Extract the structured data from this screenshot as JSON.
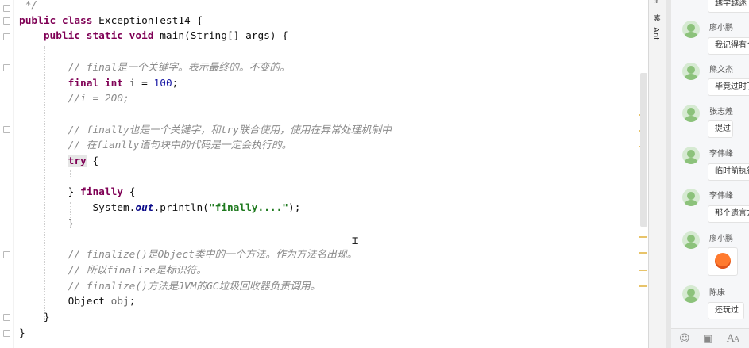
{
  "editor": {
    "lines": [
      {
        "tokens": [
          {
            "t": " */",
            "c": "cm"
          }
        ]
      },
      {
        "tokens": [
          {
            "t": "public class ",
            "c": "kw"
          },
          {
            "t": "ExceptionTest14 {",
            "c": ""
          }
        ]
      },
      {
        "tokens": [
          {
            "t": "    public static void ",
            "c": "kw"
          },
          {
            "t": "main(String[] args) {",
            "c": ""
          }
        ]
      },
      {
        "tokens": []
      },
      {
        "tokens": [
          {
            "t": "        // final是一个关键字。表示最终的。不变的。",
            "c": "cm"
          }
        ]
      },
      {
        "tokens": [
          {
            "t": "        final int ",
            "c": "kw"
          },
          {
            "t": "i",
            "c": "var"
          },
          {
            "t": " = ",
            "c": ""
          },
          {
            "t": "100",
            "c": "num"
          },
          {
            "t": ";",
            "c": ""
          }
        ]
      },
      {
        "tokens": [
          {
            "t": "        //i = 200;",
            "c": "cm"
          }
        ]
      },
      {
        "tokens": []
      },
      {
        "tokens": [
          {
            "t": "        // finally也是一个关键字，和try联合使用，使用在异常处理机制中",
            "c": "cm"
          }
        ]
      },
      {
        "tokens": [
          {
            "t": "        // 在fianlly语句块中的代码是一定会执行的。",
            "c": "cm"
          }
        ]
      },
      {
        "tokens": [
          {
            "t": "        ",
            "c": ""
          },
          {
            "t": "try",
            "c": "kw hl"
          },
          {
            "t": " {",
            "c": ""
          }
        ]
      },
      {
        "tokens": []
      },
      {
        "tokens": [
          {
            "t": "        } ",
            "c": ""
          },
          {
            "t": "finally",
            "c": "kw"
          },
          {
            "t": " {",
            "c": ""
          }
        ]
      },
      {
        "tokens": [
          {
            "t": "            System.",
            "c": ""
          },
          {
            "t": "out",
            "c": "fld"
          },
          {
            "t": ".println(",
            "c": ""
          },
          {
            "t": "\"finally....\"",
            "c": "str"
          },
          {
            "t": ");",
            "c": ""
          }
        ]
      },
      {
        "tokens": [
          {
            "t": "        }",
            "c": ""
          }
        ]
      },
      {
        "tokens": []
      },
      {
        "tokens": [
          {
            "t": "        // finalize()是Object类中的一个方法。作为方法名出现。",
            "c": "cm"
          }
        ]
      },
      {
        "tokens": [
          {
            "t": "        // 所以finalize是标识符。",
            "c": "cm"
          }
        ]
      },
      {
        "tokens": [
          {
            "t": "        // finalize()方法是JVM的GC垃圾回收器负责调用。",
            "c": "cm"
          }
        ]
      },
      {
        "tokens": [
          {
            "t": "        Object ",
            "c": ""
          },
          {
            "t": "obj",
            "c": "var"
          },
          {
            "t": ";",
            "c": ""
          }
        ]
      },
      {
        "tokens": [
          {
            "t": "    }",
            "c": ""
          }
        ]
      },
      {
        "tokens": [
          {
            "t": "}",
            "c": ""
          }
        ]
      }
    ]
  },
  "side_strip": {
    "label_top": "e",
    "label_mid": "素",
    "label_ant": "Ant"
  },
  "chat": {
    "messages": [
      {
        "name": "",
        "text": "越学越迷"
      },
      {
        "name": "廖小鹏",
        "text": "我记得有个"
      },
      {
        "name": "熊文杰",
        "text": "毕竟过时了"
      },
      {
        "name": "张志煌",
        "text": "提过"
      },
      {
        "name": "李伟峰",
        "text": "临时前执行"
      },
      {
        "name": "李伟峰",
        "text": "那个遗言方"
      },
      {
        "name": "廖小鹏",
        "text": ""
      },
      {
        "name": "陈康",
        "text": "还玩过"
      }
    ],
    "toolbar": {
      "emoji_icon": "smile-icon",
      "image_icon": "image-icon",
      "font_icon": "font-icon"
    }
  }
}
